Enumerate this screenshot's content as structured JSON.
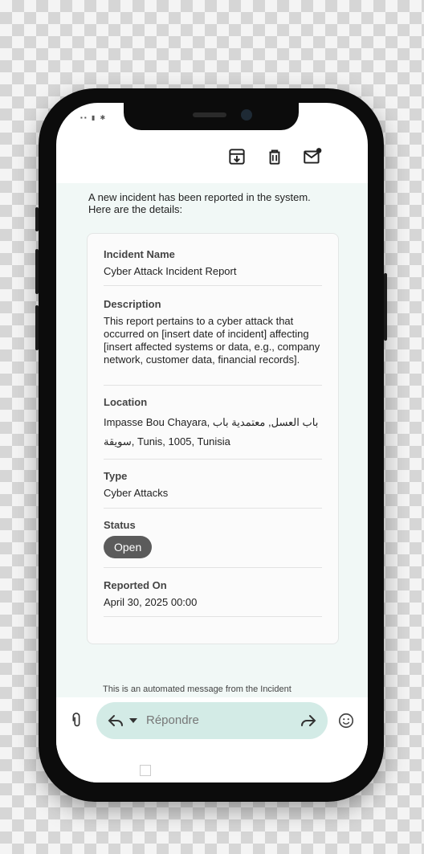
{
  "status_bar": {
    "icons": [
      "sim-icon",
      "battery-icon",
      "settings-icon"
    ]
  },
  "toolbar": {
    "icons": [
      "archive-icon",
      "delete-icon",
      "mark-unread-icon"
    ]
  },
  "email": {
    "intro_line1": "A new incident has been reported in the system.",
    "intro_line2": "Here are the details:",
    "fields": {
      "incident_name": {
        "label": "Incident Name",
        "value": "Cyber Attack Incident Report"
      },
      "description": {
        "label": "Description",
        "value": "This report pertains to a cyber attack that occurred on [insert date of incident] affecting [insert affected systems or data, e.g., company network, customer data, financial records]."
      },
      "location": {
        "label": "Location",
        "value": "Impasse Bou Chayara, باب العسل, معتمدية باب سويقة, Tunis, 1005, Tunisia"
      },
      "type": {
        "label": "Type",
        "value": "Cyber Attacks"
      },
      "status": {
        "label": "Status",
        "value": "Open"
      },
      "reported_on": {
        "label": "Reported On",
        "value": "April 30, 2025 00:00"
      }
    },
    "footer": "This is an automated message from the Incident"
  },
  "compose_bar": {
    "reply_placeholder": "Répondre",
    "icons": [
      "attach-icon",
      "reply-icon",
      "chevron-down-icon",
      "forward-icon",
      "emoji-icon"
    ]
  },
  "colors": {
    "mail_background": "#f1f8f6",
    "reply_pill": "#d3ebe6",
    "status_badge": "#5b5b5b"
  }
}
